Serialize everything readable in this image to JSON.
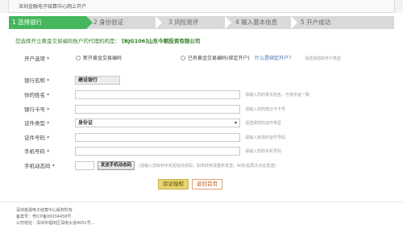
{
  "topbar": {
    "title": "深圳金融电子结算中心网上开户"
  },
  "steps": [
    {
      "label": "1 选择银行"
    },
    {
      "label": "2 身份验证"
    },
    {
      "label": "3 风险测评"
    },
    {
      "label": "4 输入基本信息"
    },
    {
      "label": "5 开户成功"
    }
  ],
  "notice": {
    "prefix": "您选择开立黄金交易编码账户的代理机构是：",
    "agency": "[BJG106]山东今朝投资有限公司"
  },
  "account_type": {
    "label": "开户选项 *",
    "option1": "新开黄金交易编码",
    "option2": "已有黄金交易编码(绑定开户)",
    "link": "什么是绑定开户？",
    "hint": "请选择您的开户类型"
  },
  "fields": {
    "bank_name": {
      "label": "银行名称 *",
      "value": "建设银行"
    },
    "name": {
      "label": "你的姓名 *",
      "hint": "请输入您的真实姓名，与身份证一致"
    },
    "bank_card": {
      "label": "银行卡号 *",
      "hint": "请输入您的借记卡卡号"
    },
    "id_type": {
      "label": "证件类型 *",
      "value": "身份证",
      "hint": "请选择您的证件类型"
    },
    "id_number": {
      "label": "证件号码 *",
      "hint": "请输入有效的证件号码"
    },
    "phone": {
      "label": "手机号码 *",
      "hint": "请输入您的手机号码"
    },
    "sms_code": {
      "label": "手机动态码 *",
      "button": "发送手机动态码",
      "hint": "(请输入您收到手机短信动态码，如未收到请重新发送，60秒后再次点击发送)"
    }
  },
  "buttons": {
    "verify": "验证授权",
    "back": "返回首页"
  },
  "footer": {
    "line1": "深圳金融电子结算中心版权所有",
    "line2": "备案号：粤ICP备00034458号",
    "line3": "公司地址：深圳市福田区深南大道4001号..."
  },
  "colors": {
    "step_active": "#45b65c",
    "notice": "#3a7f2c",
    "verify_button": "#e7d56f"
  }
}
